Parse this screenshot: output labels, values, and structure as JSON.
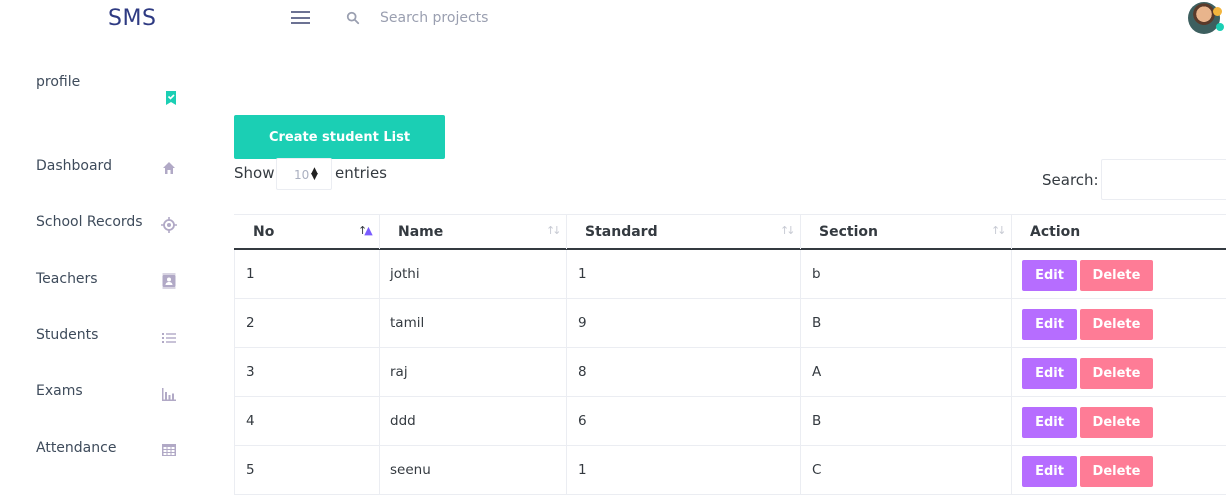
{
  "navbar": {
    "brand": "SMS",
    "search_placeholder": "Search projects",
    "menu_icon": "hamburger-icon",
    "search_icon": "search-icon"
  },
  "sidebar": {
    "profile_label": "profile",
    "profile_icon": "bookmark-check-icon",
    "items": [
      {
        "label": "Dashboard",
        "icon": "home-icon"
      },
      {
        "label": "School Records",
        "icon": "crosshairs-icon"
      },
      {
        "label": "Teachers",
        "icon": "contacts-icon"
      },
      {
        "label": "Students",
        "icon": "format-list-bulleted-icon"
      },
      {
        "label": "Exams",
        "icon": "chart-bar-icon"
      },
      {
        "label": "Attendance",
        "icon": "table-large-icon"
      }
    ]
  },
  "main": {
    "create_button": "Create student List",
    "show_label": "Show",
    "page_length": "10",
    "entries_label": "entries",
    "search_label": "Search:",
    "search_value": ""
  },
  "table": {
    "columns": [
      "No",
      "Name",
      "Standard",
      "Section",
      "Action"
    ],
    "rows": [
      {
        "no": "1",
        "name": "jothi",
        "standard": "1",
        "section": "b"
      },
      {
        "no": "2",
        "name": "tamil",
        "standard": "9",
        "section": "B"
      },
      {
        "no": "3",
        "name": "raj",
        "standard": "8",
        "section": "A"
      },
      {
        "no": "4",
        "name": "ddd",
        "standard": "6",
        "section": "B"
      },
      {
        "no": "5",
        "name": "seenu",
        "standard": "1",
        "section": "C"
      }
    ],
    "edit_label": "Edit",
    "delete_label": "Delete"
  },
  "colors": {
    "brand": "#2e3a82",
    "teal": "#1bcfb4",
    "edit": "#b66dff",
    "delete": "#fe7c96",
    "sidebar_icon": "#b1a9c6"
  }
}
